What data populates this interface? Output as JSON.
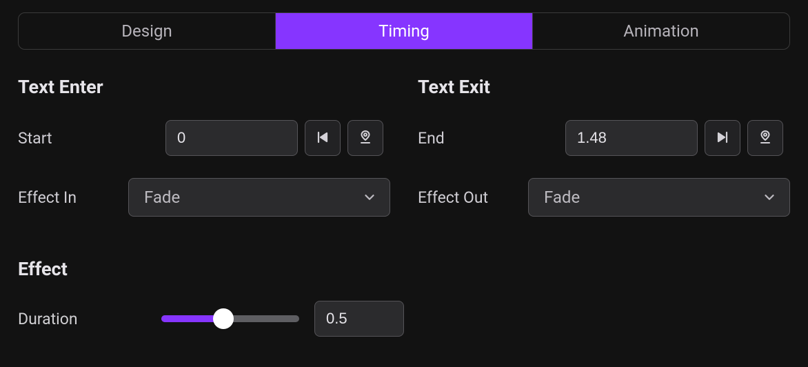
{
  "tabs": {
    "design": "Design",
    "timing": "Timing",
    "animation": "Animation",
    "active": "timing"
  },
  "textEnter": {
    "title": "Text Enter",
    "startLabel": "Start",
    "startValue": "0",
    "effectInLabel": "Effect In",
    "effectInValue": "Fade"
  },
  "textExit": {
    "title": "Text Exit",
    "endLabel": "End",
    "endValue": "1.48",
    "effectOutLabel": "Effect Out",
    "effectOutValue": "Fade"
  },
  "effect": {
    "title": "Effect",
    "durationLabel": "Duration",
    "durationValue": "0.5",
    "sliderPercent": 45
  },
  "colors": {
    "accent": "#8635ff"
  }
}
